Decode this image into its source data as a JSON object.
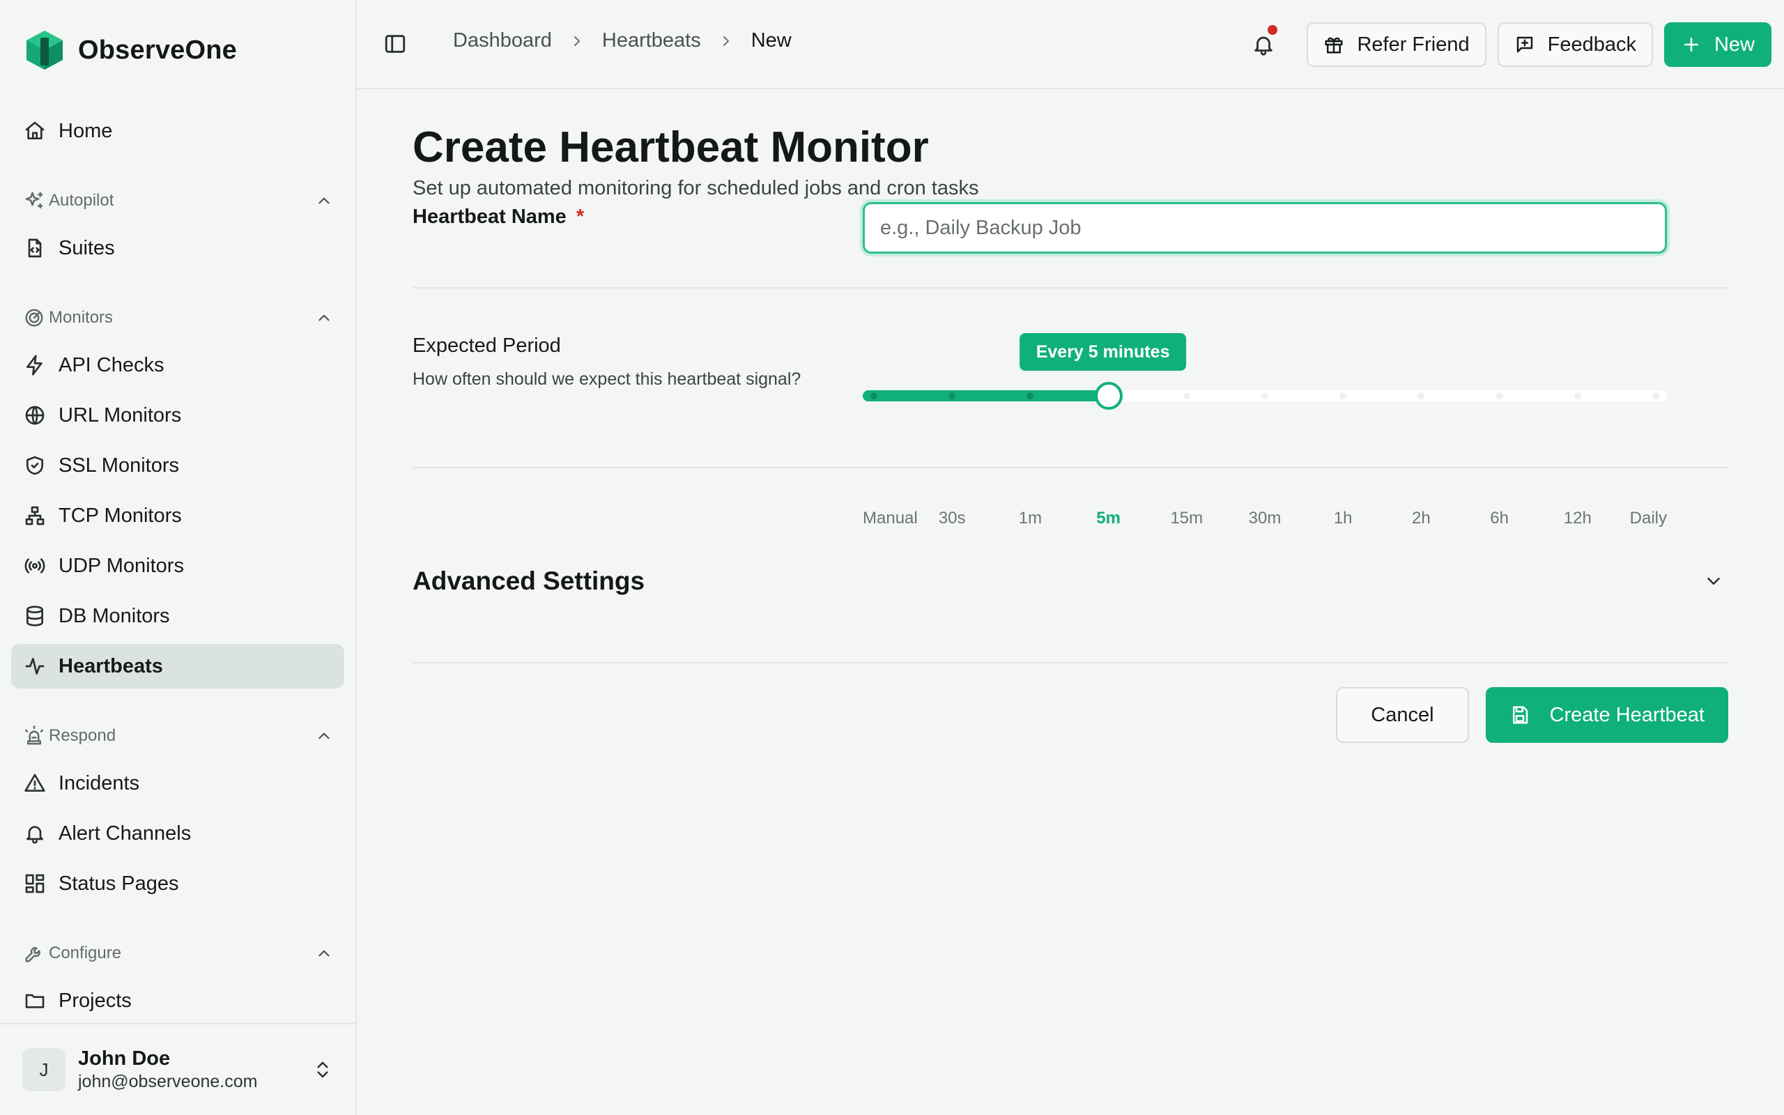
{
  "brand": {
    "name": "ObserveOne",
    "logo_icon": "hexagon-logo-icon",
    "accent": "#10b07a"
  },
  "sidebar": {
    "home": {
      "label": "Home",
      "icon": "home-icon"
    },
    "groups": [
      {
        "label": "Autopilot",
        "icon": "sparkles-icon",
        "items": [
          {
            "label": "Suites",
            "icon": "file-code-icon"
          }
        ]
      },
      {
        "label": "Monitors",
        "icon": "radar-icon",
        "items": [
          {
            "label": "API Checks",
            "icon": "zap-icon"
          },
          {
            "label": "URL Monitors",
            "icon": "globe-icon"
          },
          {
            "label": "SSL Monitors",
            "icon": "shield-icon"
          },
          {
            "label": "TCP Monitors",
            "icon": "network-icon"
          },
          {
            "label": "UDP Monitors",
            "icon": "radio-icon"
          },
          {
            "label": "DB Monitors",
            "icon": "database-icon"
          },
          {
            "label": "Heartbeats",
            "icon": "activity-icon",
            "active": true
          }
        ]
      },
      {
        "label": "Respond",
        "icon": "siren-icon",
        "items": [
          {
            "label": "Incidents",
            "icon": "alert-triangle-icon"
          },
          {
            "label": "Alert Channels",
            "icon": "bell-icon"
          },
          {
            "label": "Status Pages",
            "icon": "layout-dashboard-icon"
          }
        ]
      },
      {
        "label": "Configure",
        "icon": "wrench-icon",
        "items": [
          {
            "label": "Projects",
            "icon": "folder-icon"
          }
        ]
      }
    ],
    "user": {
      "initial": "J",
      "name": "John Doe",
      "email": "john@observeone.com"
    }
  },
  "topbar": {
    "breadcrumb": [
      "Dashboard",
      "Heartbeats",
      "New"
    ],
    "refer_label": "Refer Friend",
    "feedback_label": "Feedback",
    "new_label": "New",
    "notification_dot_color": "#d62828"
  },
  "page": {
    "title": "Create Heartbeat Monitor",
    "subtitle": "Set up automated monitoring for scheduled jobs and cron tasks",
    "name_label": "Heartbeat Name",
    "required_mark": "*",
    "name_value": "",
    "name_placeholder": "e.g., Daily Backup Job",
    "period_label": "Expected Period",
    "period_help": "How often should we expect this heartbeat signal?",
    "period_options": [
      "Manual",
      "30s",
      "1m",
      "5m",
      "15m",
      "30m",
      "1h",
      "2h",
      "6h",
      "12h",
      "Daily"
    ],
    "period_selected_index": 3,
    "period_tooltip": "Every 5 minutes",
    "advanced_title": "Advanced Settings",
    "cancel_label": "Cancel",
    "create_label": "Create Heartbeat"
  }
}
